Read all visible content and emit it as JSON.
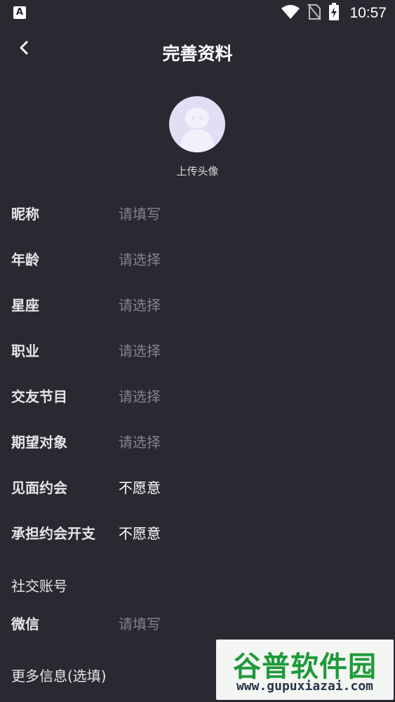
{
  "status_bar": {
    "app_icon_letter": "A",
    "time": "10:57"
  },
  "header": {
    "title": "完善资料"
  },
  "avatar": {
    "caption": "上传头像"
  },
  "form": {
    "rows": [
      {
        "label": "昵称",
        "value": "请填写",
        "state": "placeholder"
      },
      {
        "label": "年龄",
        "value": "请选择",
        "state": "placeholder"
      },
      {
        "label": "星座",
        "value": "请选择",
        "state": "placeholder"
      },
      {
        "label": "职业",
        "value": "请选择",
        "state": "placeholder"
      },
      {
        "label": "交友节目",
        "value": "请选择",
        "state": "placeholder"
      },
      {
        "label": "期望对象",
        "value": "请选择",
        "state": "placeholder"
      },
      {
        "label": "见面约会",
        "value": "不愿意",
        "state": "filled"
      },
      {
        "label": "承担约会开支",
        "value": "不愿意",
        "state": "filled"
      }
    ]
  },
  "social": {
    "section_title": "社交账号",
    "wechat": {
      "label": "微信",
      "value": "请填写"
    }
  },
  "more_info": {
    "label": "更多信息(选填)"
  },
  "watermark": {
    "logo_text": "谷普软件园",
    "url": "www.gupuxiazai.com"
  },
  "colors": {
    "background": "#2b2832",
    "placeholder": "#85828c",
    "avatar_bg": "#e4def5",
    "watermark_green": "#1f9a3b"
  }
}
